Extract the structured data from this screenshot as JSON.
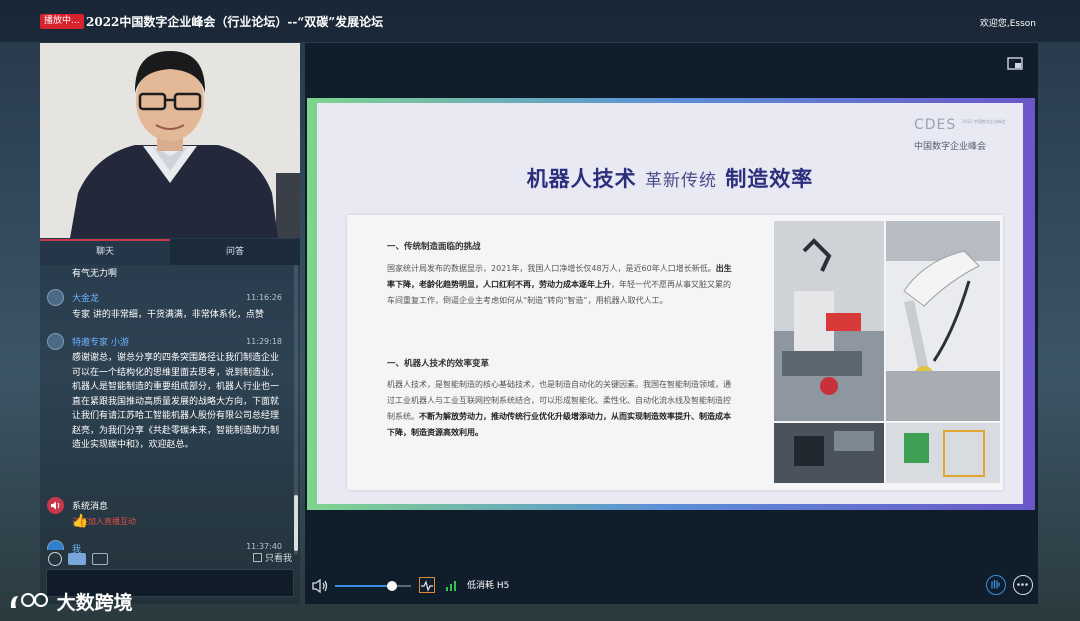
{
  "header": {
    "live_badge": "播放中...",
    "title": "2022中国数字企业峰会（行业论坛）--“双碳”发展论坛",
    "welcome": "欢迎您,Esson"
  },
  "sidebar": {
    "tabs": [
      {
        "label": "聊天",
        "active": true
      },
      {
        "label": "问答",
        "active": false
      }
    ],
    "messages": [
      {
        "name": "",
        "time": "",
        "text": "有气无力啊"
      },
      {
        "name": "大金龙",
        "time": "11:16:26",
        "text": "专家 讲的非常细，干货满满，非常体系化，点赞"
      },
      {
        "name": "特邀专家 小游",
        "time": "11:29:18",
        "text": "感谢谢总，谢总分享的四条突围路径让我们制造企业可以在一个结构化的思维里面去思考，说到制造业，机器人是智能制造的重要组成部分，机器人行业也一直在紧跟我国推动高质量发展的战略大方向，下面就让我们有请江苏哈工智能机器人股份有限公司总经理赵亮，为我们分享《共赴零碳未来，智能制造助力制造业实现碳中和》，欢迎赵总。"
      },
      {
        "name": "系统消息",
        "time": "",
        "text": "正在加入直播互动"
      },
      {
        "name": "我",
        "time": "11:37:40",
        "text": "👍"
      }
    ],
    "only_me_label": "只看我",
    "input_placeholder": ""
  },
  "slide": {
    "title_left": "机器人技术",
    "title_mid": "革新传统",
    "title_right": "制造效率",
    "logo_abbr": "CDES",
    "logo_small": "2022 中国数字企业峰会",
    "logo_cn": "中国数字企业峰会",
    "section1_heading": "一、传统制造面临的挑战",
    "section1_text_a": "国家统计局发布的数据显示，2021年，我国人口净增长仅48万人，是近60年人口增长新低。",
    "section1_text_b": "出生率下降，老龄化趋势明显，人口红利不再，劳动力成本逐年上升",
    "section1_text_c": "，年轻一代不愿再从事又脏又累的车间重复工作，倒逼企业主考虑如何从“制造”转向“智造”，用机器人取代人工。",
    "section2_heading": "一、机器人技术的效率变革",
    "section2_text_a": "机器人技术，是智能制造的核心基础技术，也是制造自动化的关键因素。我国在智能制造领域，通过工业机器人与工业互联网控制系统结合，可以形成智能化、柔性化、自动化流水线及智能制造控制系统。",
    "section2_text_b": "不断为解放劳动力，推动传统行业优化升级增添动力，从而实现制造效率提升、制造成本下降，制造资源高效利用。"
  },
  "player": {
    "volume": 0.75,
    "quality": "低消耗 H5"
  },
  "watermark": "大数跨境",
  "colors": {
    "live_red": "#d8232f",
    "link_blue": "#6fb4ff",
    "slide_title": "#2c2f7c"
  }
}
